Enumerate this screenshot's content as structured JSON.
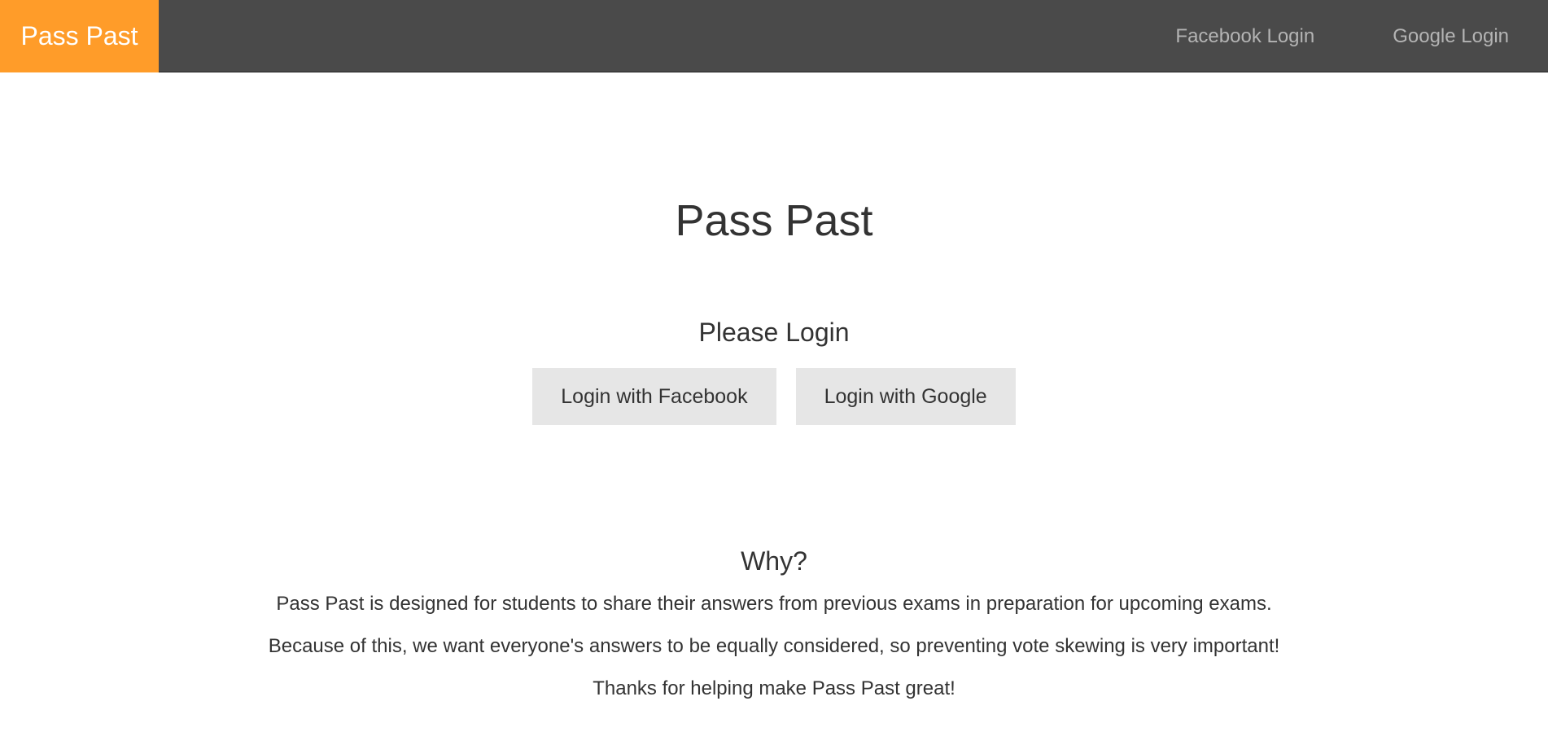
{
  "navbar": {
    "brand": "Pass Past",
    "links": [
      {
        "label": "Facebook Login"
      },
      {
        "label": "Google Login"
      }
    ],
    "colors": {
      "background": "#4a4a4a",
      "brand": "#ff9c29",
      "link": "#b4b4b4"
    }
  },
  "main": {
    "title": "Pass Past",
    "subtitle": "Please Login",
    "buttons": {
      "facebook": "Login with Facebook",
      "google": "Login with Google"
    },
    "why": {
      "title": "Why?",
      "paragraphs": [
        "Pass Past is designed for students to share their answers from previous exams in preparation for upcoming exams.",
        "Because of this, we want everyone's answers to be equally considered, so preventing vote skewing is very important!",
        "Thanks for helping make Pass Past great!"
      ]
    }
  }
}
